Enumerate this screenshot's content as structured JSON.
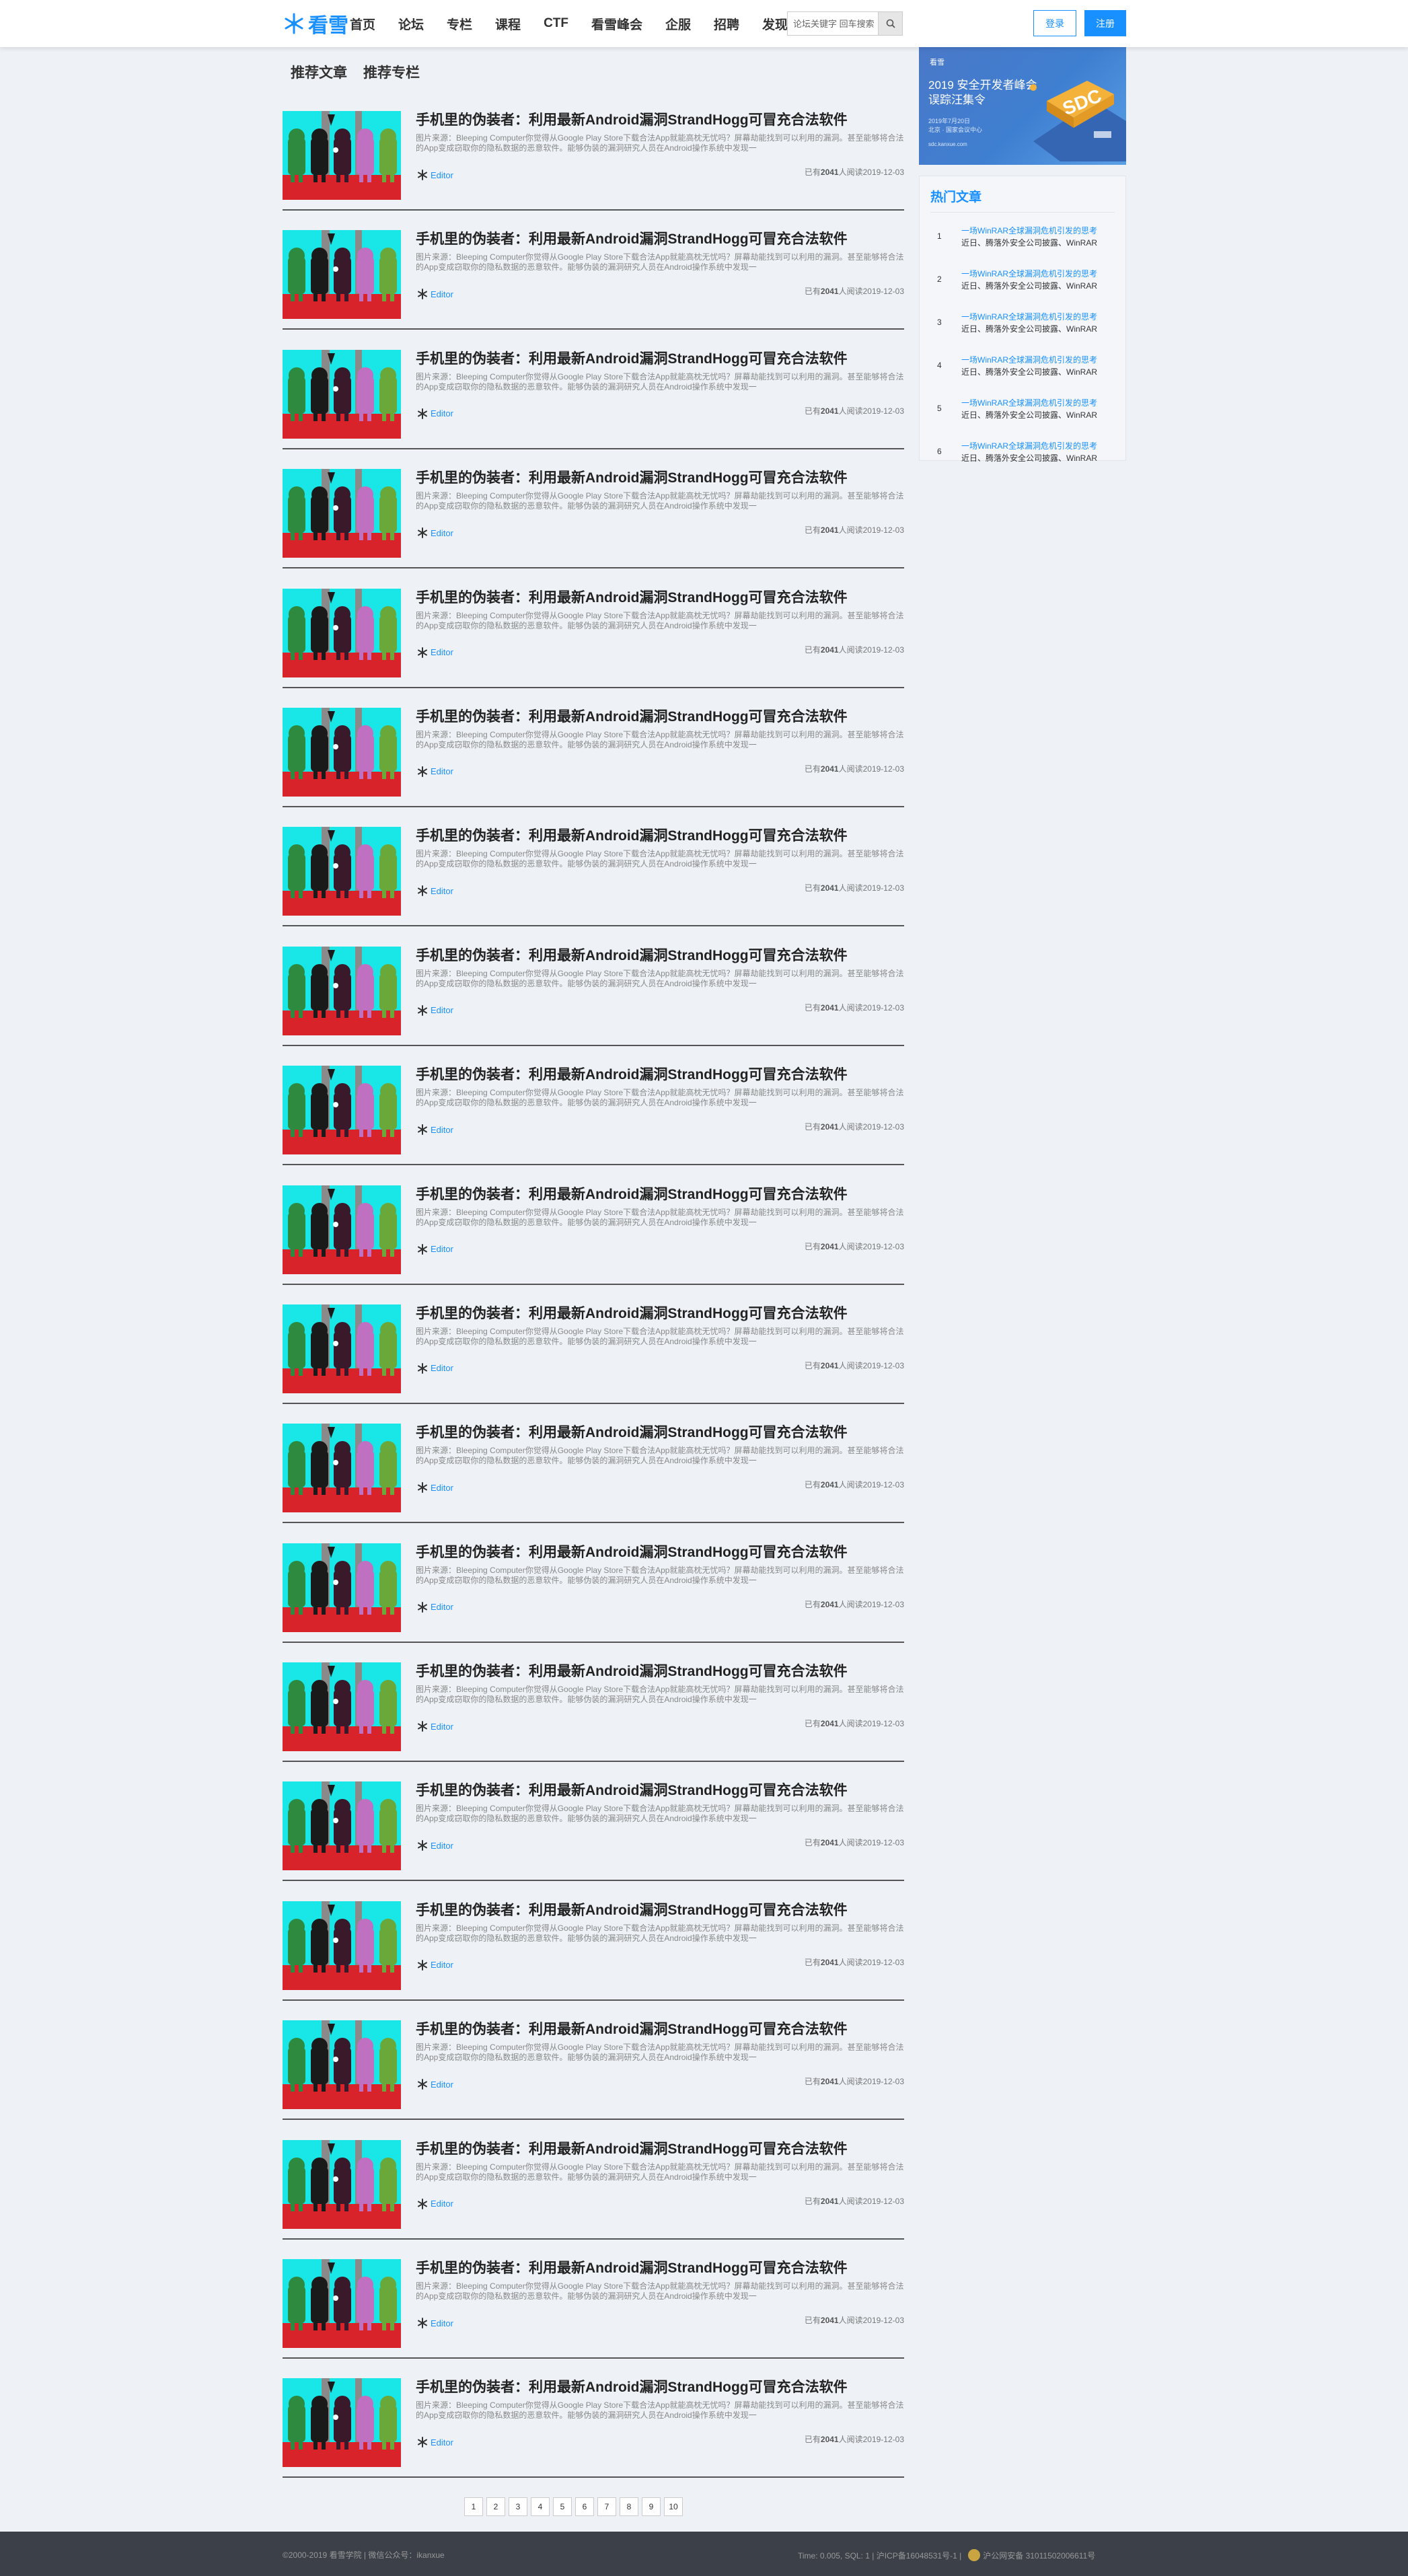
{
  "colors": {
    "accent": "#1890ff",
    "background": "#eef2f6",
    "footer": "#3c4048"
  },
  "header": {
    "logo_text": "看雪",
    "nav": [
      "首页",
      "论坛",
      "专栏",
      "课程",
      "CTF",
      "看雪峰会",
      "企服",
      "招聘"
    ],
    "nav_more": "发现",
    "search_placeholder": "论坛关键字 回车搜索",
    "login_label": "登录",
    "register_label": "注册"
  },
  "tabs": [
    "推荐文章",
    "推荐专栏"
  ],
  "articles": [
    {
      "title": "手机里的伪装者：利用最新Android漏洞StrandHogg可冒充合法软件",
      "excerpt": "图片来源：Bleeping Computer你觉得从Google Play Store下载合法App就能高枕无忧吗？屏幕劫能找到可以利用的漏洞。甚至能够将合法的App变成窃取你的隐私数据的恶意软件。能够伪装的漏洞研究人员在Android操作系统中发现一",
      "author": "Editor",
      "readers": "2041",
      "meta_prefix": "已有",
      "meta_suffix": "人阅读",
      "date": "2019-12-03"
    },
    {
      "title": "手机里的伪装者：利用最新Android漏洞StrandHogg可冒充合法软件",
      "excerpt": "图片来源：Bleeping Computer你觉得从Google Play Store下载合法App就能高枕无忧吗？屏幕劫能找到可以利用的漏洞。甚至能够将合法的App变成窃取你的隐私数据的恶意软件。能够伪装的漏洞研究人员在Android操作系统中发现一",
      "author": "Editor",
      "readers": "2041",
      "meta_prefix": "已有",
      "meta_suffix": "人阅读",
      "date": "2019-12-03"
    },
    {
      "title": "手机里的伪装者：利用最新Android漏洞StrandHogg可冒充合法软件",
      "excerpt": "图片来源：Bleeping Computer你觉得从Google Play Store下载合法App就能高枕无忧吗？屏幕劫能找到可以利用的漏洞。甚至能够将合法的App变成窃取你的隐私数据的恶意软件。能够伪装的漏洞研究人员在Android操作系统中发现一",
      "author": "Editor",
      "readers": "2041",
      "meta_prefix": "已有",
      "meta_suffix": "人阅读",
      "date": "2019-12-03"
    },
    {
      "title": "手机里的伪装者：利用最新Android漏洞StrandHogg可冒充合法软件",
      "excerpt": "图片来源：Bleeping Computer你觉得从Google Play Store下载合法App就能高枕无忧吗？屏幕劫能找到可以利用的漏洞。甚至能够将合法的App变成窃取你的隐私数据的恶意软件。能够伪装的漏洞研究人员在Android操作系统中发现一",
      "author": "Editor",
      "readers": "2041",
      "meta_prefix": "已有",
      "meta_suffix": "人阅读",
      "date": "2019-12-03"
    },
    {
      "title": "手机里的伪装者：利用最新Android漏洞StrandHogg可冒充合法软件",
      "excerpt": "图片来源：Bleeping Computer你觉得从Google Play Store下载合法App就能高枕无忧吗？屏幕劫能找到可以利用的漏洞。甚至能够将合法的App变成窃取你的隐私数据的恶意软件。能够伪装的漏洞研究人员在Android操作系统中发现一",
      "author": "Editor",
      "readers": "2041",
      "meta_prefix": "已有",
      "meta_suffix": "人阅读",
      "date": "2019-12-03"
    },
    {
      "title": "手机里的伪装者：利用最新Android漏洞StrandHogg可冒充合法软件",
      "excerpt": "图片来源：Bleeping Computer你觉得从Google Play Store下载合法App就能高枕无忧吗？屏幕劫能找到可以利用的漏洞。甚至能够将合法的App变成窃取你的隐私数据的恶意软件。能够伪装的漏洞研究人员在Android操作系统中发现一",
      "author": "Editor",
      "readers": "2041",
      "meta_prefix": "已有",
      "meta_suffix": "人阅读",
      "date": "2019-12-03"
    },
    {
      "title": "手机里的伪装者：利用最新Android漏洞StrandHogg可冒充合法软件",
      "excerpt": "图片来源：Bleeping Computer你觉得从Google Play Store下载合法App就能高枕无忧吗？屏幕劫能找到可以利用的漏洞。甚至能够将合法的App变成窃取你的隐私数据的恶意软件。能够伪装的漏洞研究人员在Android操作系统中发现一",
      "author": "Editor",
      "readers": "2041",
      "meta_prefix": "已有",
      "meta_suffix": "人阅读",
      "date": "2019-12-03"
    },
    {
      "title": "手机里的伪装者：利用最新Android漏洞StrandHogg可冒充合法软件",
      "excerpt": "图片来源：Bleeping Computer你觉得从Google Play Store下载合法App就能高枕无忧吗？屏幕劫能找到可以利用的漏洞。甚至能够将合法的App变成窃取你的隐私数据的恶意软件。能够伪装的漏洞研究人员在Android操作系统中发现一",
      "author": "Editor",
      "readers": "2041",
      "meta_prefix": "已有",
      "meta_suffix": "人阅读",
      "date": "2019-12-03"
    },
    {
      "title": "手机里的伪装者：利用最新Android漏洞StrandHogg可冒充合法软件",
      "excerpt": "图片来源：Bleeping Computer你觉得从Google Play Store下载合法App就能高枕无忧吗？屏幕劫能找到可以利用的漏洞。甚至能够将合法的App变成窃取你的隐私数据的恶意软件。能够伪装的漏洞研究人员在Android操作系统中发现一",
      "author": "Editor",
      "readers": "2041",
      "meta_prefix": "已有",
      "meta_suffix": "人阅读",
      "date": "2019-12-03"
    },
    {
      "title": "手机里的伪装者：利用最新Android漏洞StrandHogg可冒充合法软件",
      "excerpt": "图片来源：Bleeping Computer你觉得从Google Play Store下载合法App就能高枕无忧吗？屏幕劫能找到可以利用的漏洞。甚至能够将合法的App变成窃取你的隐私数据的恶意软件。能够伪装的漏洞研究人员在Android操作系统中发现一",
      "author": "Editor",
      "readers": "2041",
      "meta_prefix": "已有",
      "meta_suffix": "人阅读",
      "date": "2019-12-03"
    },
    {
      "title": "手机里的伪装者：利用最新Android漏洞StrandHogg可冒充合法软件",
      "excerpt": "图片来源：Bleeping Computer你觉得从Google Play Store下载合法App就能高枕无忧吗？屏幕劫能找到可以利用的漏洞。甚至能够将合法的App变成窃取你的隐私数据的恶意软件。能够伪装的漏洞研究人员在Android操作系统中发现一",
      "author": "Editor",
      "readers": "2041",
      "meta_prefix": "已有",
      "meta_suffix": "人阅读",
      "date": "2019-12-03"
    },
    {
      "title": "手机里的伪装者：利用最新Android漏洞StrandHogg可冒充合法软件",
      "excerpt": "图片来源：Bleeping Computer你觉得从Google Play Store下载合法App就能高枕无忧吗？屏幕劫能找到可以利用的漏洞。甚至能够将合法的App变成窃取你的隐私数据的恶意软件。能够伪装的漏洞研究人员在Android操作系统中发现一",
      "author": "Editor",
      "readers": "2041",
      "meta_prefix": "已有",
      "meta_suffix": "人阅读",
      "date": "2019-12-03"
    },
    {
      "title": "手机里的伪装者：利用最新Android漏洞StrandHogg可冒充合法软件",
      "excerpt": "图片来源：Bleeping Computer你觉得从Google Play Store下载合法App就能高枕无忧吗？屏幕劫能找到可以利用的漏洞。甚至能够将合法的App变成窃取你的隐私数据的恶意软件。能够伪装的漏洞研究人员在Android操作系统中发现一",
      "author": "Editor",
      "readers": "2041",
      "meta_prefix": "已有",
      "meta_suffix": "人阅读",
      "date": "2019-12-03"
    },
    {
      "title": "手机里的伪装者：利用最新Android漏洞StrandHogg可冒充合法软件",
      "excerpt": "图片来源：Bleeping Computer你觉得从Google Play Store下载合法App就能高枕无忧吗？屏幕劫能找到可以利用的漏洞。甚至能够将合法的App变成窃取你的隐私数据的恶意软件。能够伪装的漏洞研究人员在Android操作系统中发现一",
      "author": "Editor",
      "readers": "2041",
      "meta_prefix": "已有",
      "meta_suffix": "人阅读",
      "date": "2019-12-03"
    },
    {
      "title": "手机里的伪装者：利用最新Android漏洞StrandHogg可冒充合法软件",
      "excerpt": "图片来源：Bleeping Computer你觉得从Google Play Store下载合法App就能高枕无忧吗？屏幕劫能找到可以利用的漏洞。甚至能够将合法的App变成窃取你的隐私数据的恶意软件。能够伪装的漏洞研究人员在Android操作系统中发现一",
      "author": "Editor",
      "readers": "2041",
      "meta_prefix": "已有",
      "meta_suffix": "人阅读",
      "date": "2019-12-03"
    },
    {
      "title": "手机里的伪装者：利用最新Android漏洞StrandHogg可冒充合法软件",
      "excerpt": "图片来源：Bleeping Computer你觉得从Google Play Store下载合法App就能高枕无忧吗？屏幕劫能找到可以利用的漏洞。甚至能够将合法的App变成窃取你的隐私数据的恶意软件。能够伪装的漏洞研究人员在Android操作系统中发现一",
      "author": "Editor",
      "readers": "2041",
      "meta_prefix": "已有",
      "meta_suffix": "人阅读",
      "date": "2019-12-03"
    },
    {
      "title": "手机里的伪装者：利用最新Android漏洞StrandHogg可冒充合法软件",
      "excerpt": "图片来源：Bleeping Computer你觉得从Google Play Store下载合法App就能高枕无忧吗？屏幕劫能找到可以利用的漏洞。甚至能够将合法的App变成窃取你的隐私数据的恶意软件。能够伪装的漏洞研究人员在Android操作系统中发现一",
      "author": "Editor",
      "readers": "2041",
      "meta_prefix": "已有",
      "meta_suffix": "人阅读",
      "date": "2019-12-03"
    },
    {
      "title": "手机里的伪装者：利用最新Android漏洞StrandHogg可冒充合法软件",
      "excerpt": "图片来源：Bleeping Computer你觉得从Google Play Store下载合法App就能高枕无忧吗？屏幕劫能找到可以利用的漏洞。甚至能够将合法的App变成窃取你的隐私数据的恶意软件。能够伪装的漏洞研究人员在Android操作系统中发现一",
      "author": "Editor",
      "readers": "2041",
      "meta_prefix": "已有",
      "meta_suffix": "人阅读",
      "date": "2019-12-03"
    },
    {
      "title": "手机里的伪装者：利用最新Android漏洞StrandHogg可冒充合法软件",
      "excerpt": "图片来源：Bleeping Computer你觉得从Google Play Store下载合法App就能高枕无忧吗？屏幕劫能找到可以利用的漏洞。甚至能够将合法的App变成窃取你的隐私数据的恶意软件。能够伪装的漏洞研究人员在Android操作系统中发现一",
      "author": "Editor",
      "readers": "2041",
      "meta_prefix": "已有",
      "meta_suffix": "人阅读",
      "date": "2019-12-03"
    },
    {
      "title": "手机里的伪装者：利用最新Android漏洞StrandHogg可冒充合法软件",
      "excerpt": "图片来源：Bleeping Computer你觉得从Google Play Store下载合法App就能高枕无忧吗？屏幕劫能找到可以利用的漏洞。甚至能够将合法的App变成窃取你的隐私数据的恶意软件。能够伪装的漏洞研究人员在Android操作系统中发现一",
      "author": "Editor",
      "readers": "2041",
      "meta_prefix": "已有",
      "meta_suffix": "人阅读",
      "date": "2019-12-03"
    }
  ],
  "pagination": [
    "1",
    "2",
    "3",
    "4",
    "5",
    "6",
    "7",
    "8",
    "9",
    "10"
  ],
  "sidebar": {
    "banner": {
      "brand": "看雪",
      "title": "2019 安全开发者峰会\n误踪汪集令",
      "sub1": "2019年7月20日",
      "sub2": "北京 · 国家会议中心",
      "url": "sdc.kanxue.com",
      "logo_text": "SDC"
    },
    "hot_title": "热门文章",
    "hot": [
      {
        "num": "1",
        "link": "一场WinRAR全球漏洞危机引发的思考",
        "desc": "近日、腾落外安全公司披露、WinRAR"
      },
      {
        "num": "2",
        "link": "一场WinRAR全球漏洞危机引发的思考",
        "desc": "近日、腾落外安全公司披露、WinRAR"
      },
      {
        "num": "3",
        "link": "一场WinRAR全球漏洞危机引发的思考",
        "desc": "近日、腾落外安全公司披露、WinRAR"
      },
      {
        "num": "4",
        "link": "一场WinRAR全球漏洞危机引发的思考",
        "desc": "近日、腾落外安全公司披露、WinRAR"
      },
      {
        "num": "5",
        "link": "一场WinRAR全球漏洞危机引发的思考",
        "desc": "近日、腾落外安全公司披露、WinRAR"
      },
      {
        "num": "6",
        "link": "一场WinRAR全球漏洞危机引发的思考",
        "desc": "近日、腾落外安全公司披露、WinRAR"
      }
    ]
  },
  "footer": {
    "left": "©2000-2019 看雪学院 | 微信公众号：ikanxue",
    "right1": "Time: 0.005, SQL: 1 | 沪ICP备16048531号-1 |",
    "right2": "沪公网安备 31011502006611号"
  }
}
